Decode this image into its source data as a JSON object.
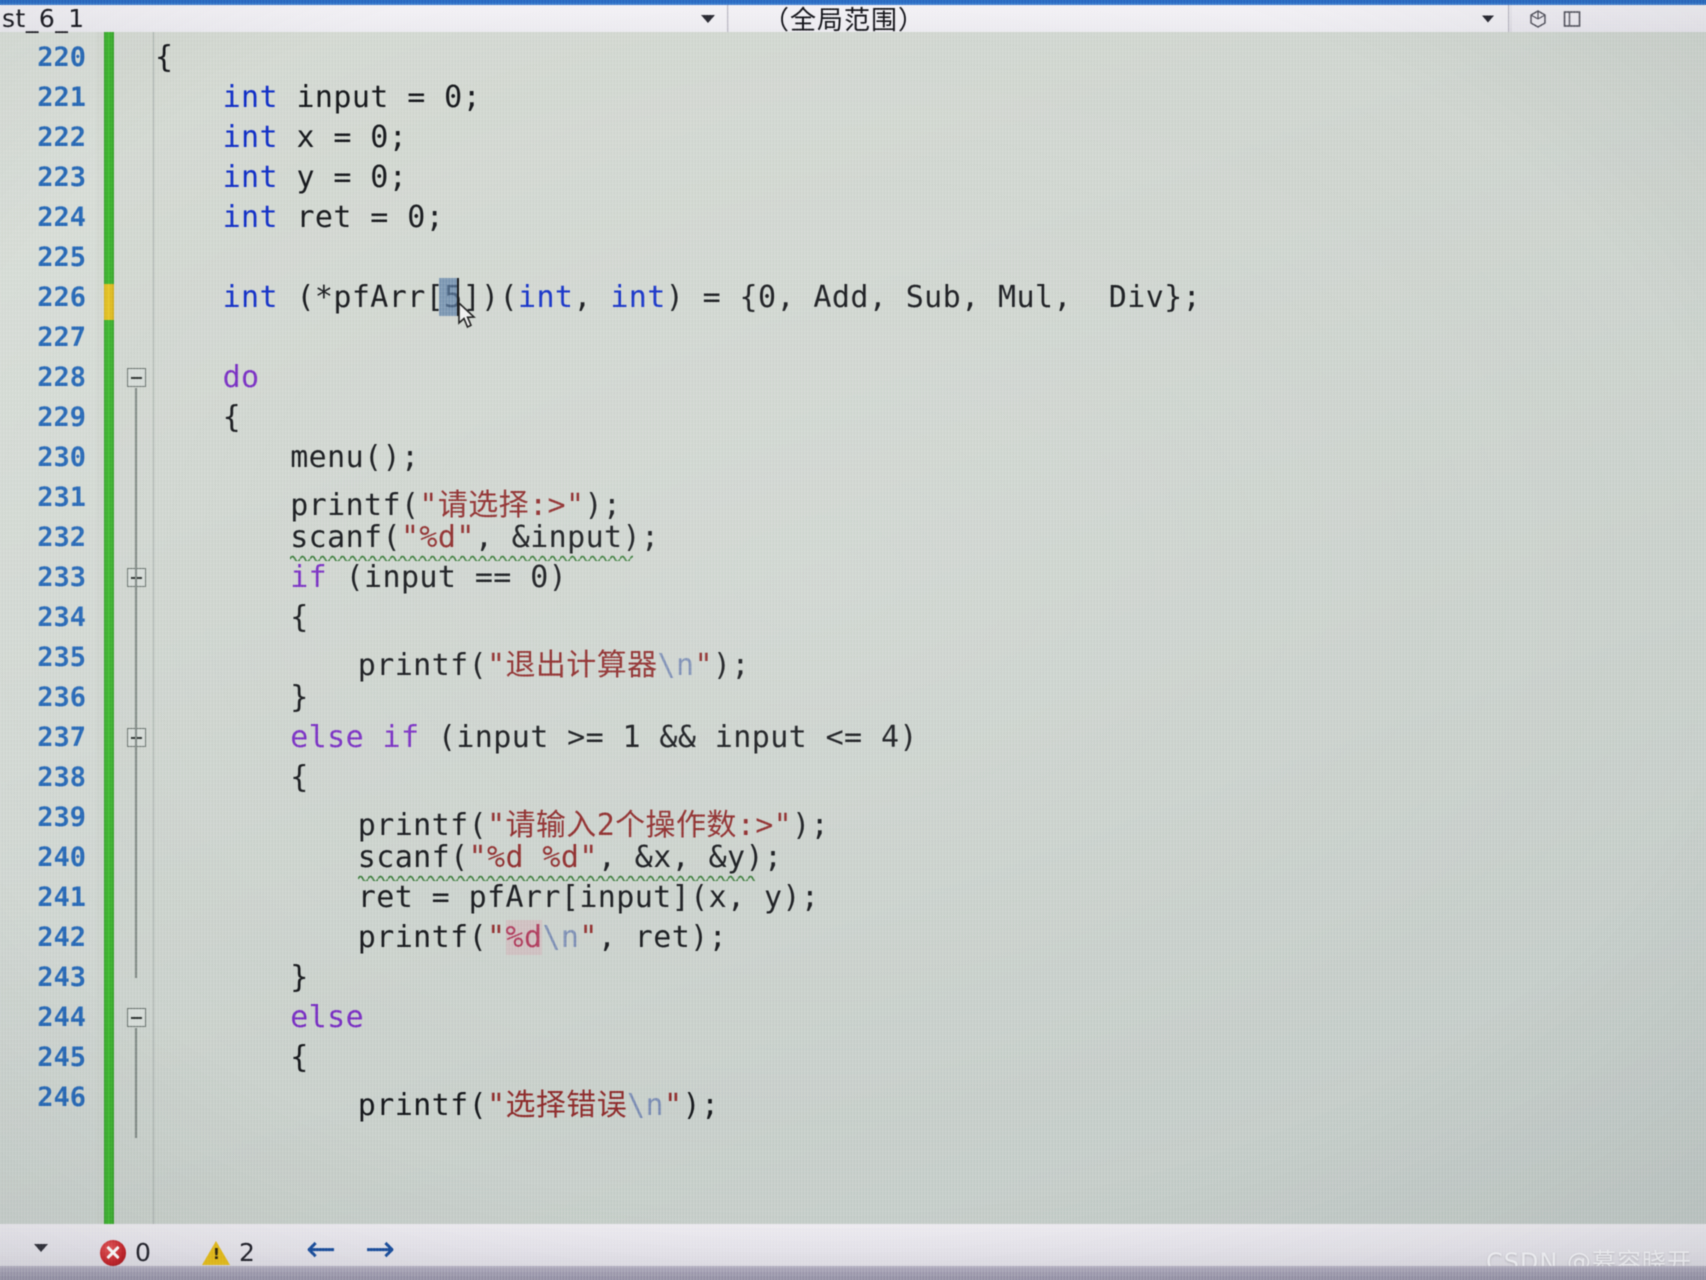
{
  "window": {
    "title": "Visual Studio C source editor"
  },
  "topbar": {
    "scope_left": "st_6_1",
    "scope_right": "（全局范围）",
    "left_dropdown_icon": "chevron-down-icon",
    "right_dropdown_icon": "chevron-down-icon",
    "icons": [
      "cube-icon",
      "panel-icon"
    ]
  },
  "editor": {
    "first_line": 220,
    "lines": [
      {
        "n": 220,
        "indent": 0,
        "tokens": [
          {
            "t": "{",
            "c": "punc"
          }
        ]
      },
      {
        "n": 221,
        "indent": 2,
        "tokens": [
          {
            "t": "int",
            "c": "kw"
          },
          {
            "t": " input = 0;",
            "c": "punc"
          }
        ]
      },
      {
        "n": 222,
        "indent": 2,
        "tokens": [
          {
            "t": "int",
            "c": "kw"
          },
          {
            "t": " x = 0;",
            "c": "punc"
          }
        ]
      },
      {
        "n": 223,
        "indent": 2,
        "tokens": [
          {
            "t": "int",
            "c": "kw"
          },
          {
            "t": " y = 0;",
            "c": "punc"
          }
        ]
      },
      {
        "n": 224,
        "indent": 2,
        "tokens": [
          {
            "t": "int",
            "c": "kw"
          },
          {
            "t": " ret = 0;",
            "c": "punc"
          }
        ]
      },
      {
        "n": 225,
        "indent": 0,
        "tokens": []
      },
      {
        "n": 226,
        "indent": 2,
        "tokens": [
          {
            "t": "int",
            "c": "kw"
          },
          {
            "t": " (*pfArr[5])(",
            "c": "punc"
          },
          {
            "t": "int",
            "c": "kw"
          },
          {
            "t": ", ",
            "c": "punc"
          },
          {
            "t": "int",
            "c": "kw"
          },
          {
            "t": ") = {0, Add, Sub, Mul,  Div};",
            "c": "punc"
          }
        ]
      },
      {
        "n": 227,
        "indent": 0,
        "tokens": []
      },
      {
        "n": 228,
        "indent": 2,
        "tokens": [
          {
            "t": "do",
            "c": "kw2"
          }
        ]
      },
      {
        "n": 229,
        "indent": 2,
        "tokens": [
          {
            "t": "{",
            "c": "punc"
          }
        ]
      },
      {
        "n": 230,
        "indent": 4,
        "tokens": [
          {
            "t": "menu();",
            "c": "punc"
          }
        ]
      },
      {
        "n": 231,
        "indent": 4,
        "tokens": [
          {
            "t": "printf(",
            "c": "punc"
          },
          {
            "t": "\"请选择:>\"",
            "c": "str"
          },
          {
            "t": ");",
            "c": "punc"
          }
        ]
      },
      {
        "n": 232,
        "indent": 4,
        "tokens": [
          {
            "t": "scanf(",
            "c": "punc"
          },
          {
            "t": "\"%d\"",
            "c": "str"
          },
          {
            "t": ", &input);",
            "c": "punc"
          }
        ]
      },
      {
        "n": 233,
        "indent": 4,
        "tokens": [
          {
            "t": "if",
            "c": "kw2"
          },
          {
            "t": " (input == 0)",
            "c": "punc"
          }
        ]
      },
      {
        "n": 234,
        "indent": 4,
        "tokens": [
          {
            "t": "{",
            "c": "punc"
          }
        ]
      },
      {
        "n": 235,
        "indent": 6,
        "tokens": [
          {
            "t": "printf(",
            "c": "punc"
          },
          {
            "t": "\"退出计算器",
            "c": "str"
          },
          {
            "t": "\\n",
            "c": "esc"
          },
          {
            "t": "\"",
            "c": "str"
          },
          {
            "t": ");",
            "c": "punc"
          }
        ]
      },
      {
        "n": 236,
        "indent": 4,
        "tokens": [
          {
            "t": "}",
            "c": "punc"
          }
        ]
      },
      {
        "n": 237,
        "indent": 4,
        "tokens": [
          {
            "t": "else if",
            "c": "kw2"
          },
          {
            "t": " (input >= 1 && input <= 4)",
            "c": "punc"
          }
        ]
      },
      {
        "n": 238,
        "indent": 4,
        "tokens": [
          {
            "t": "{",
            "c": "punc"
          }
        ]
      },
      {
        "n": 239,
        "indent": 6,
        "tokens": [
          {
            "t": "printf(",
            "c": "punc"
          },
          {
            "t": "\"请输入2个操作数:>\"",
            "c": "str"
          },
          {
            "t": ");",
            "c": "punc"
          }
        ]
      },
      {
        "n": 240,
        "indent": 6,
        "tokens": [
          {
            "t": "scanf(",
            "c": "punc"
          },
          {
            "t": "\"%d %d\"",
            "c": "str"
          },
          {
            "t": ", &x, &y);",
            "c": "punc"
          }
        ]
      },
      {
        "n": 241,
        "indent": 6,
        "tokens": [
          {
            "t": "ret = pfArr[input](x, y);",
            "c": "punc"
          }
        ]
      },
      {
        "n": 242,
        "indent": 6,
        "tokens": [
          {
            "t": "printf(",
            "c": "punc"
          },
          {
            "t": "\"",
            "c": "str"
          },
          {
            "t": "%d",
            "c": "fmt"
          },
          {
            "t": "\\n",
            "c": "esc"
          },
          {
            "t": "\"",
            "c": "str"
          },
          {
            "t": ", ret);",
            "c": "punc"
          }
        ]
      },
      {
        "n": 243,
        "indent": 4,
        "tokens": [
          {
            "t": "}",
            "c": "punc"
          }
        ]
      },
      {
        "n": 244,
        "indent": 4,
        "tokens": [
          {
            "t": "else",
            "c": "kw2"
          }
        ]
      },
      {
        "n": 245,
        "indent": 4,
        "tokens": [
          {
            "t": "{",
            "c": "punc"
          }
        ]
      },
      {
        "n": 246,
        "indent": 6,
        "tokens": [
          {
            "t": "printf(",
            "c": "punc"
          },
          {
            "t": "\"选择错误",
            "c": "str"
          },
          {
            "t": "\\n",
            "c": "esc"
          },
          {
            "t": "\"",
            "c": "str"
          },
          {
            "t": ");",
            "c": "punc"
          }
        ]
      }
    ],
    "selection": {
      "line": 226,
      "text": "5"
    },
    "squiggle_lines": [
      232,
      240
    ],
    "fold_markers": [
      228,
      233,
      237,
      244
    ],
    "change_bar": {
      "modified_line": 226,
      "saved_color": "#45bd36",
      "unsaved_color": "#e8c82c"
    }
  },
  "statusbar": {
    "errors_icon": "error-icon",
    "errors_count": "0",
    "warnings_icon": "warning-icon",
    "warnings_count": "2",
    "back_icon": "arrow-left-icon",
    "forward_icon": "arrow-right-icon",
    "dropdown_icon": "chevron-down-icon"
  },
  "watermark": {
    "text": "CSDN @慕容晓开"
  },
  "colors": {
    "keyword": "#1230c8",
    "control_keyword": "#7a2fc4",
    "string": "#8f2b2b",
    "escape": "#7d8fb5",
    "format_specifier": "#b03a5c",
    "line_number": "#2b6cb8",
    "accent": "#2d6fc4",
    "changebar_saved": "#45bd36",
    "changebar_unsaved": "#e8c82c",
    "editor_bg": "#d1d7d1"
  }
}
